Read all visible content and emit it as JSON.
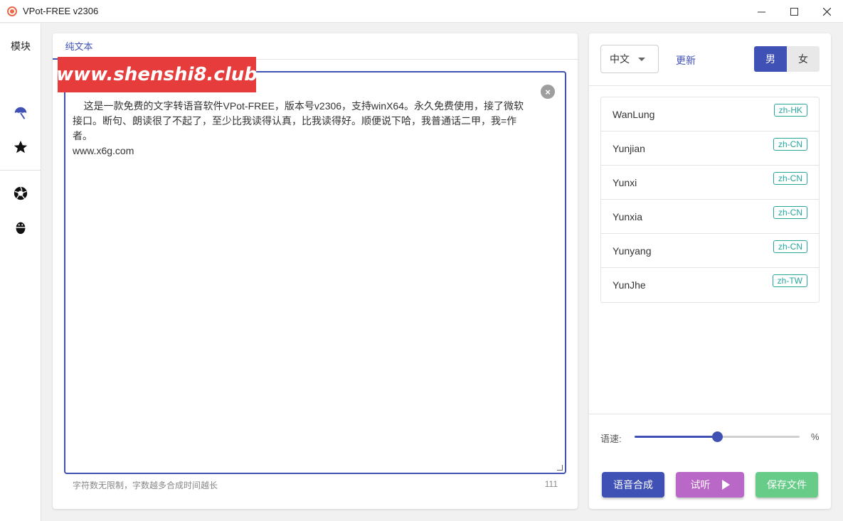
{
  "window": {
    "title": "VPot-FREE v2306",
    "controls": [
      "minimize",
      "maximize",
      "close"
    ]
  },
  "sidebar": {
    "title": "模块",
    "icons": [
      "umbrella-icon",
      "star-icon",
      "aperture-icon",
      "bug-icon"
    ]
  },
  "editor": {
    "tab_label": "纯文本",
    "text": "这是一款免费的文字转语音软件VPot-FREE，版本号v2306，支持winX64。永久免费使用，接了微软接口。断句、朗读很了不起了，至少比我读得认真，比我读得好。顺便说下哈，我普通话二甲，我=作者。\nwww.x6g.com",
    "hint": "字符数无限制，字数越多合成时间越长",
    "count": "111"
  },
  "watermark": {
    "text": "www.shenshi8.club"
  },
  "voice_panel": {
    "language": "中文",
    "update_label": "更新",
    "gender_male": "男",
    "gender_female": "女",
    "selected_gender": "男",
    "voices": [
      {
        "name": "WanLung",
        "locale": "zh-HK"
      },
      {
        "name": "Yunjian",
        "locale": "zh-CN"
      },
      {
        "name": "Yunxi",
        "locale": "zh-CN"
      },
      {
        "name": "Yunxia",
        "locale": "zh-CN"
      },
      {
        "name": "Yunyang",
        "locale": "zh-CN"
      },
      {
        "name": "YunJhe",
        "locale": "zh-TW"
      }
    ],
    "speed_label": "语速:",
    "speed_value": 0.5,
    "speed_unit": "%",
    "synth_label": "语音合成",
    "listen_label": "试听",
    "save_label": "保存文件"
  },
  "colors": {
    "primary": "#3f51b5",
    "tag": "#26a69a",
    "listen": "#ba68c8",
    "save": "#66cc88",
    "watermark": "#e63c3c"
  }
}
